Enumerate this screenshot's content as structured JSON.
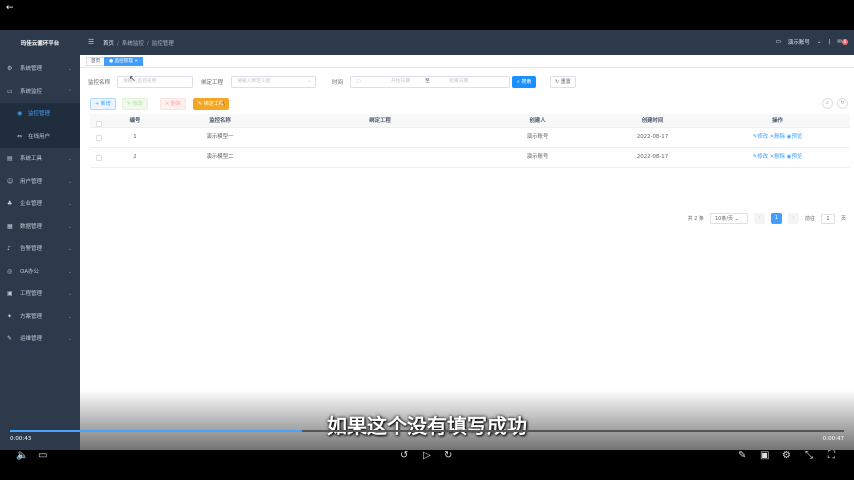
{
  "player": {
    "back_icon": "back-arrow-icon",
    "subtitle": "如果这个没有填写成功",
    "time_current": "0:00:43",
    "time_total": "0:00:47",
    "progress": 0.35
  },
  "sidebar": {
    "brand": "玛佳云循环平台",
    "items": [
      {
        "label": "系统管理",
        "icon": "gear-icon"
      },
      {
        "label": "系统监控",
        "icon": "monitor-icon"
      },
      {
        "label": "监控管理",
        "icon": "eye-icon",
        "active": true
      },
      {
        "label": "在线用户",
        "icon": "link-icon"
      },
      {
        "label": "系统工具",
        "icon": "tool-icon"
      },
      {
        "label": "用户管理",
        "icon": "user-icon"
      },
      {
        "label": "企业管理",
        "icon": "company-icon"
      },
      {
        "label": "数据管理",
        "icon": "data-icon"
      },
      {
        "label": "告警管理",
        "icon": "alert-icon"
      },
      {
        "label": "OA办公",
        "icon": "globe-icon"
      },
      {
        "label": "工程管理",
        "icon": "project-icon"
      },
      {
        "label": "方案管理",
        "icon": "plan-icon"
      },
      {
        "label": "运维管理",
        "icon": "wrench-icon"
      }
    ]
  },
  "header": {
    "breadcrumb": [
      "首页",
      "系统监控",
      "监控管理"
    ],
    "account": "演示账号",
    "badge_count": "6"
  },
  "tabs": [
    "首页",
    "监控管理"
  ],
  "search": {
    "name_label": "监控名称",
    "name_placeholder": "请输入监控名称",
    "project_label": "绑定工程",
    "project_placeholder": "请输入绑定工程",
    "time_label": "时间",
    "start_placeholder": "开始日期",
    "range_sep": "至",
    "end_placeholder": "结束日期",
    "search_btn": "搜索",
    "reset_btn": "重置"
  },
  "actions": {
    "add": "新增",
    "edit": "修改",
    "delete": "删除",
    "bind": "绑定工程"
  },
  "table": {
    "headers": [
      "编号",
      "监控名称",
      "绑定工程",
      "创建人",
      "创建时间",
      "操作"
    ],
    "rows": [
      {
        "id": "1",
        "name": "演示模型一",
        "project": "",
        "creator": "演示账号",
        "time": "2022-08-17"
      },
      {
        "id": "2",
        "name": "演示模型二",
        "project": "",
        "creator": "演示账号",
        "time": "2022-08-17"
      }
    ],
    "ops": {
      "edit": "修改",
      "delete": "删除",
      "preview": "预览"
    }
  },
  "pagination": {
    "total": "共 2 条",
    "page_size": "10条/页",
    "current_page": "1",
    "goto_label": "前往",
    "goto_value": "1",
    "page_unit": "页"
  }
}
